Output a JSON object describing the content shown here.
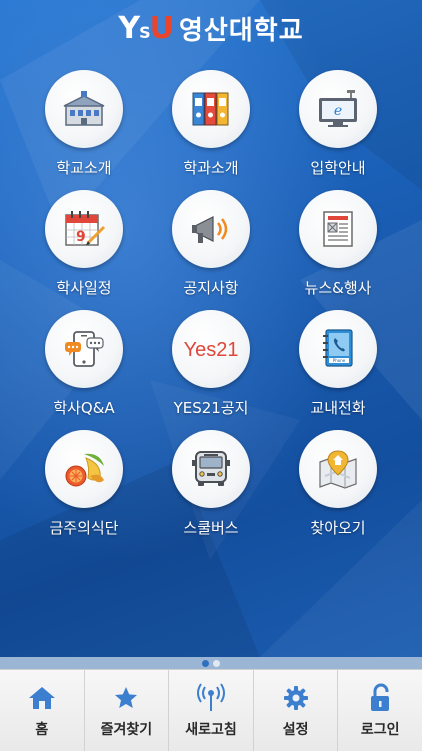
{
  "header": {
    "logo_mark_y": "Y",
    "logo_mark_s": "S",
    "logo_mark_u": "U",
    "title": "영산대학교"
  },
  "menu": [
    {
      "label": "학교소개",
      "icon": "school-building-icon"
    },
    {
      "label": "학과소개",
      "icon": "binders-icon"
    },
    {
      "label": "입학안내",
      "icon": "monitor-icon"
    },
    {
      "label": "학사일정",
      "icon": "calendar-icon"
    },
    {
      "label": "공지사항",
      "icon": "megaphone-icon"
    },
    {
      "label": "뉴스&행사",
      "icon": "newspaper-icon"
    },
    {
      "label": "학사Q&A",
      "icon": "phone-chat-icon"
    },
    {
      "label": "YES21공지",
      "icon": "yes21-icon",
      "icon_text": "Yes21"
    },
    {
      "label": "교내전화",
      "icon": "phonebook-icon",
      "icon_text": "Phone"
    },
    {
      "label": "금주의식단",
      "icon": "fruit-icon"
    },
    {
      "label": "스쿨버스",
      "icon": "bus-icon"
    },
    {
      "label": "찾아오기",
      "icon": "map-pin-icon"
    }
  ],
  "pager": {
    "active_page": 1,
    "page_count": 2
  },
  "tabs": [
    {
      "label": "홈",
      "icon": "home-icon"
    },
    {
      "label": "즐겨찾기",
      "icon": "star-icon"
    },
    {
      "label": "새로고침",
      "icon": "signal-icon"
    },
    {
      "label": "설정",
      "icon": "gear-icon"
    },
    {
      "label": "로그인",
      "icon": "lock-icon"
    }
  ],
  "colors": {
    "background": "#1b62b8",
    "logo_accent": "#e8452c",
    "tab_icon": "#3d7fcf"
  }
}
